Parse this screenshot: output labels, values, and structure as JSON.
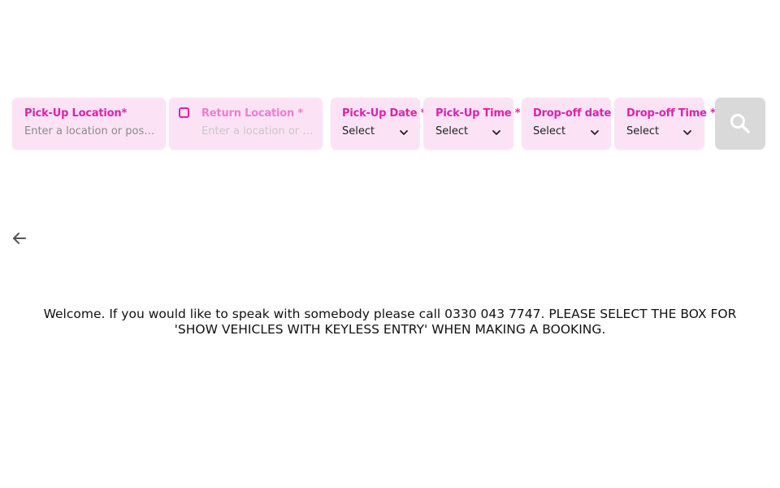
{
  "booking_bar": {
    "pickup_location": {
      "label": "Pick-Up Location*",
      "placeholder": "Enter a location or post code"
    },
    "return_location": {
      "label": "Return Location *",
      "placeholder": "Enter a location or post code",
      "checkbox_checked": false
    },
    "pickup_date": {
      "label": "Pick-Up Date *",
      "value": "Select"
    },
    "pickup_time": {
      "label": "Pick-Up Time *",
      "value": "Select"
    },
    "dropoff_date": {
      "label": "Drop-off date *",
      "value": "Select"
    },
    "dropoff_time": {
      "label": "Drop-off Time *",
      "value": "Select"
    },
    "search_button_icon": "search-icon"
  },
  "navigation": {
    "back_icon": "arrow-left-icon"
  },
  "welcome_message": "Welcome. If you would like to speak with somebody please call 0330 043 7747. PLEASE SELECT THE BOX FOR 'SHOW VEHICLES WITH KEYLESS ENTRY' WHEN MAKING A BOOKING.",
  "colors": {
    "accent": "#e020ad",
    "field_background": "#fbe3f5",
    "search_button_background": "#d9d9d9"
  }
}
